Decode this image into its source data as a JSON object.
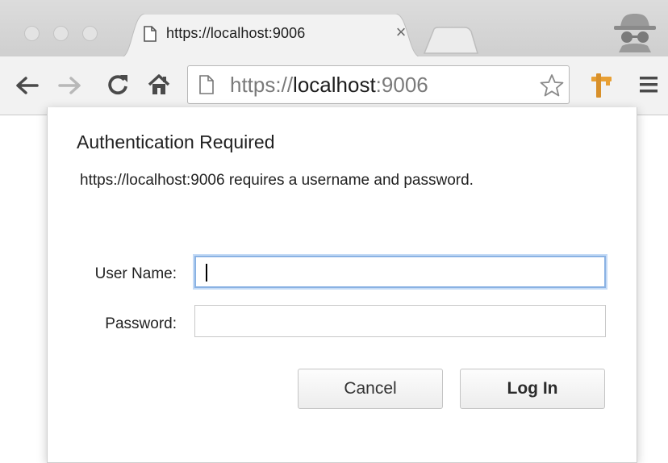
{
  "browser": {
    "tab": {
      "title": "https://localhost:9006",
      "close_glyph": "×",
      "icon": "page-icon"
    },
    "toolbar": {
      "back_icon": "back-arrow-icon",
      "forward_icon": "forward-arrow-icon",
      "reload_icon": "reload-icon",
      "home_icon": "home-icon",
      "url_prefix": "https://",
      "url_host": "localhost",
      "url_suffix": ":9006",
      "star_icon": "star-icon",
      "extension_icon": "extension-icon",
      "menu_icon": "hamburger-menu-icon"
    },
    "incognito_icon": "incognito-icon"
  },
  "dialog": {
    "title": "Authentication Required",
    "message": "https://localhost:9006 requires a username and password.",
    "username_label": "User Name:",
    "username_value": "",
    "password_label": "Password:",
    "password_value": "",
    "cancel_label": "Cancel",
    "login_label": "Log In"
  },
  "colors": {
    "focus_ring": "#8ab2e3",
    "extension_orange": "#e8a035"
  }
}
